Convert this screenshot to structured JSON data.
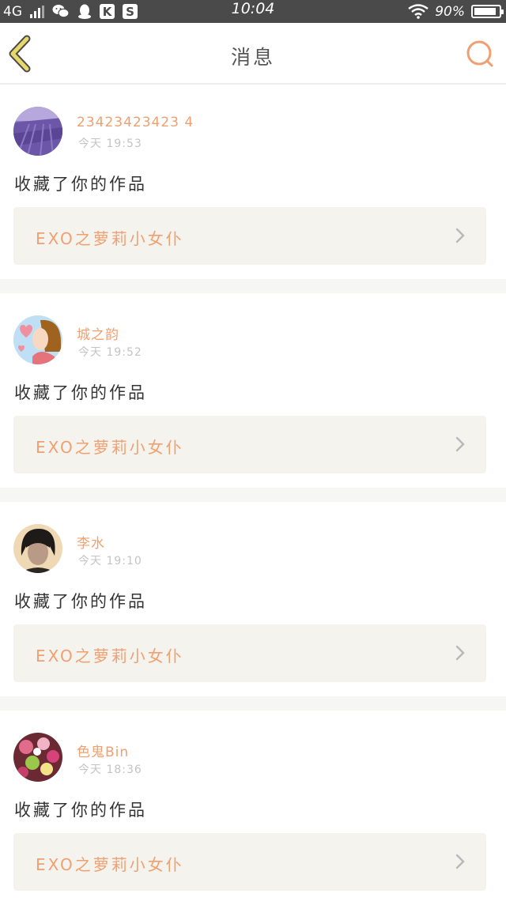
{
  "status_bar": {
    "network": "4G",
    "time": "10:04",
    "battery": "90%",
    "battery_level": 0.9,
    "icons": [
      "signal-icon",
      "wechat-icon",
      "qq-icon",
      "k-app-icon",
      "s-app-icon",
      "wifi-icon",
      "battery-icon"
    ],
    "k_label": "K",
    "s_label": "S"
  },
  "header": {
    "title": "消息",
    "back_icon": "chevron-left-icon",
    "search_icon": "search-icon"
  },
  "colors": {
    "accent": "#f0a070",
    "back_icon": "#e8d86a",
    "card_bg": "#f4f3ee",
    "separator": "#f6f6f4"
  },
  "notifications": [
    {
      "username": "23423423423 4",
      "time": "今天 19:53",
      "action": "收藏了你的作品",
      "work_title": "EXO之萝莉小女仆",
      "avatar": "lavender-field-avatar"
    },
    {
      "username": "城之韵",
      "time": "今天 19:52",
      "action": "收藏了你的作品",
      "work_title": "EXO之萝莉小女仆",
      "avatar": "cartoon-girl-avatar"
    },
    {
      "username": "李水",
      "time": "今天 19:10",
      "action": "收藏了你的作品",
      "work_title": "EXO之萝莉小女仆",
      "avatar": "portrait-avatar"
    },
    {
      "username": "色鬼Bin",
      "time": "今天 18:36",
      "action": "收藏了你的作品",
      "work_title": "EXO之萝莉小女仆",
      "avatar": "candy-avatar"
    }
  ]
}
